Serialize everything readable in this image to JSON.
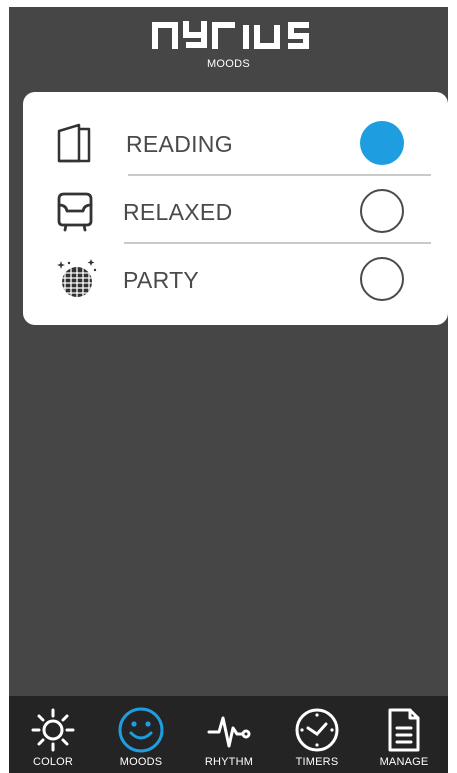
{
  "header": {
    "brand": "nyrius",
    "subtitle": "MOODS"
  },
  "moods": [
    {
      "label": "READING",
      "icon": "book-icon",
      "selected": true
    },
    {
      "label": "RELAXED",
      "icon": "armchair-icon",
      "selected": false
    },
    {
      "label": "PARTY",
      "icon": "disco-ball-icon",
      "selected": false
    }
  ],
  "tabs": [
    {
      "label": "COLOR",
      "icon": "sun-icon",
      "active": false
    },
    {
      "label": "MOODS",
      "icon": "smiley-icon",
      "active": true
    },
    {
      "label": "RHYTHM",
      "icon": "heartbeat-icon",
      "active": false
    },
    {
      "label": "TIMERS",
      "icon": "clock-icon",
      "active": false
    },
    {
      "label": "MANAGE",
      "icon": "document-icon",
      "active": false
    }
  ],
  "colors": {
    "accent": "#1e9ee0",
    "background": "#464646",
    "tabbar": "#242424",
    "card": "#ffffff"
  }
}
